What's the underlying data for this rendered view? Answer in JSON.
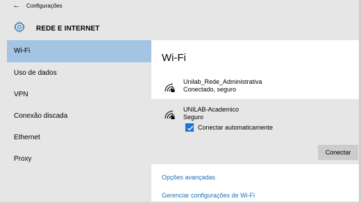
{
  "titlebar": {
    "back_icon": "arrow-left-icon",
    "title": "Configurações"
  },
  "header": {
    "icon": "gear-icon",
    "title": "REDE E INTERNET"
  },
  "sidebar": {
    "items": [
      {
        "label": "Wi-Fi",
        "selected": true
      },
      {
        "label": "Uso de dados",
        "selected": false
      },
      {
        "label": "VPN",
        "selected": false
      },
      {
        "label": "Conexão discada",
        "selected": false
      },
      {
        "label": "Ethernet",
        "selected": false
      },
      {
        "label": "Proxy",
        "selected": false
      }
    ]
  },
  "main": {
    "title": "Wi-Fi",
    "networks": [
      {
        "name": "Unilab_Rede_Administrativa",
        "status": "Conectado, seguro",
        "icon": "wifi-secure-icon"
      },
      {
        "name": "UNILAB-Academico",
        "status": "Seguro",
        "icon": "wifi-secure-icon",
        "auto_connect_label": "Conectar automaticamente",
        "auto_connect_checked": true,
        "connect_button": "Conectar"
      }
    ],
    "links": {
      "advanced": "Opções avançadas",
      "manage": "Gerenciar configurações de Wi-Fi"
    }
  },
  "colors": {
    "selected_nav": "#a4c4e4",
    "panel_bg": "#e6e6e6",
    "link": "#1a6fb8",
    "checkbox": "#1a73d8"
  }
}
